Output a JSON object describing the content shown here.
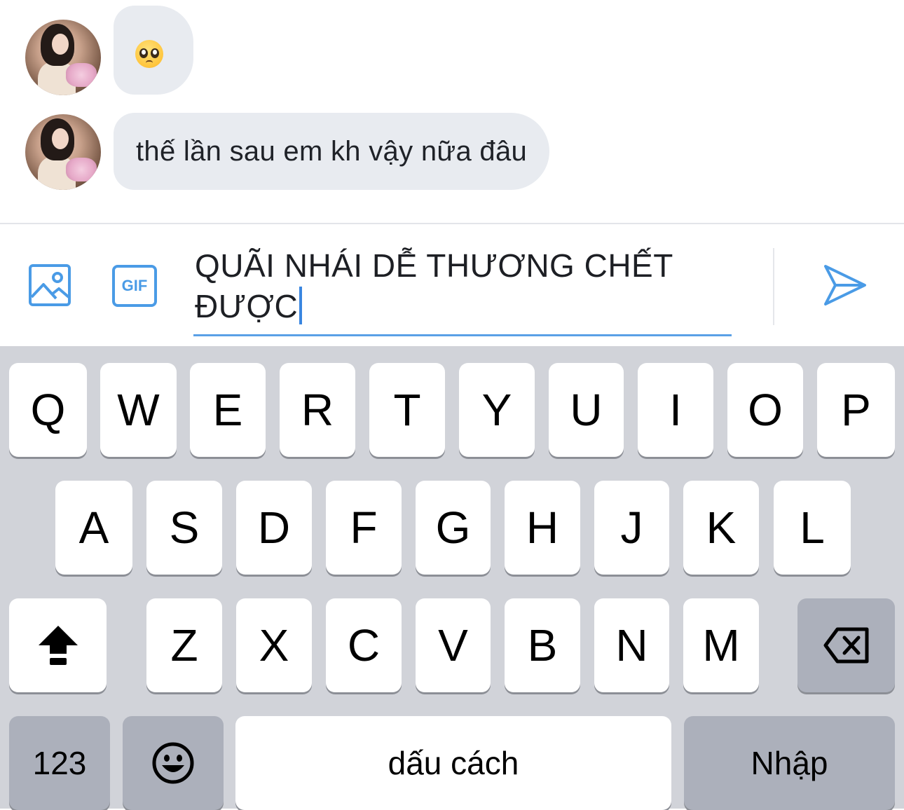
{
  "messages": [
    {
      "type": "emoji",
      "emoji_name": "pleading-face-emoji"
    },
    {
      "type": "text",
      "text": "thế lần sau em kh vậy nữa đâu"
    }
  ],
  "composer": {
    "value": "QUÃI NHÁI DỄ THƯƠNG CHẾT ĐƯỢC",
    "icons": [
      "image-icon",
      "gif-icon",
      "send-icon"
    ],
    "gif_label": "GIF",
    "accent_color": "#4a9be6"
  },
  "keyboard": {
    "row1": [
      "Q",
      "W",
      "E",
      "R",
      "T",
      "Y",
      "U",
      "I",
      "O",
      "P"
    ],
    "row2": [
      "A",
      "S",
      "D",
      "F",
      "G",
      "H",
      "J",
      "K",
      "L"
    ],
    "row3": [
      "Z",
      "X",
      "C",
      "V",
      "B",
      "N",
      "M"
    ],
    "numbers_label": "123",
    "space_label": "dấu cách",
    "return_label": "Nhập",
    "icons": [
      "shift-icon",
      "backspace-icon",
      "emoji-keyboard-icon"
    ]
  }
}
